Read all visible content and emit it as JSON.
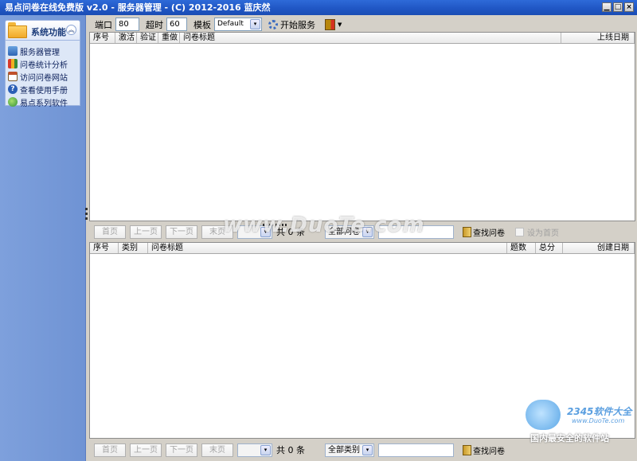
{
  "window": {
    "title": "易点问卷在线免费版 v2.0 - 服务器管理 - (C) 2012-2016 蓝庆然",
    "controls": [
      "minimize",
      "maximize",
      "close"
    ]
  },
  "sidebar": {
    "panel_title": "系统功能",
    "items": [
      {
        "label": "服务器管理",
        "icon": "server-icon"
      },
      {
        "label": "问卷统计分析",
        "icon": "chart-icon"
      },
      {
        "label": "访问问卷网站",
        "icon": "home-icon"
      },
      {
        "label": "查看使用手册",
        "icon": "help-icon"
      },
      {
        "label": "易点系列软件",
        "icon": "globe-icon"
      }
    ]
  },
  "toolbar": {
    "port_label": "端口",
    "port_value": "80",
    "timeout_label": "超时",
    "timeout_value": "60",
    "template_label": "模板",
    "template_value": "Default",
    "start_label": "开始服务"
  },
  "grid_top": {
    "columns": [
      "序号",
      "激活",
      "验证",
      "重做",
      "问卷标题",
      "上线日期"
    ]
  },
  "pager_top": {
    "first": "首页",
    "prev": "上一页",
    "next": "下一页",
    "last": "末页",
    "count": "共 0 条",
    "filter": "全部问卷",
    "search": "查找问卷",
    "set_home": "设为首页"
  },
  "grid_bottom": {
    "columns": [
      "序号",
      "类别",
      "问卷标题",
      "题数",
      "总分",
      "创建日期"
    ]
  },
  "pager_bottom": {
    "first": "首页",
    "prev": "上一页",
    "next": "下一页",
    "last": "末页",
    "count": "共 0 条",
    "filter": "全部类别",
    "search": "查找问卷"
  },
  "watermarks": {
    "duote": "www.DuoTe.com",
    "brand": "2345软件大全",
    "url": "www.DuoTe.com",
    "tagline": "国内最安全的软件站"
  }
}
